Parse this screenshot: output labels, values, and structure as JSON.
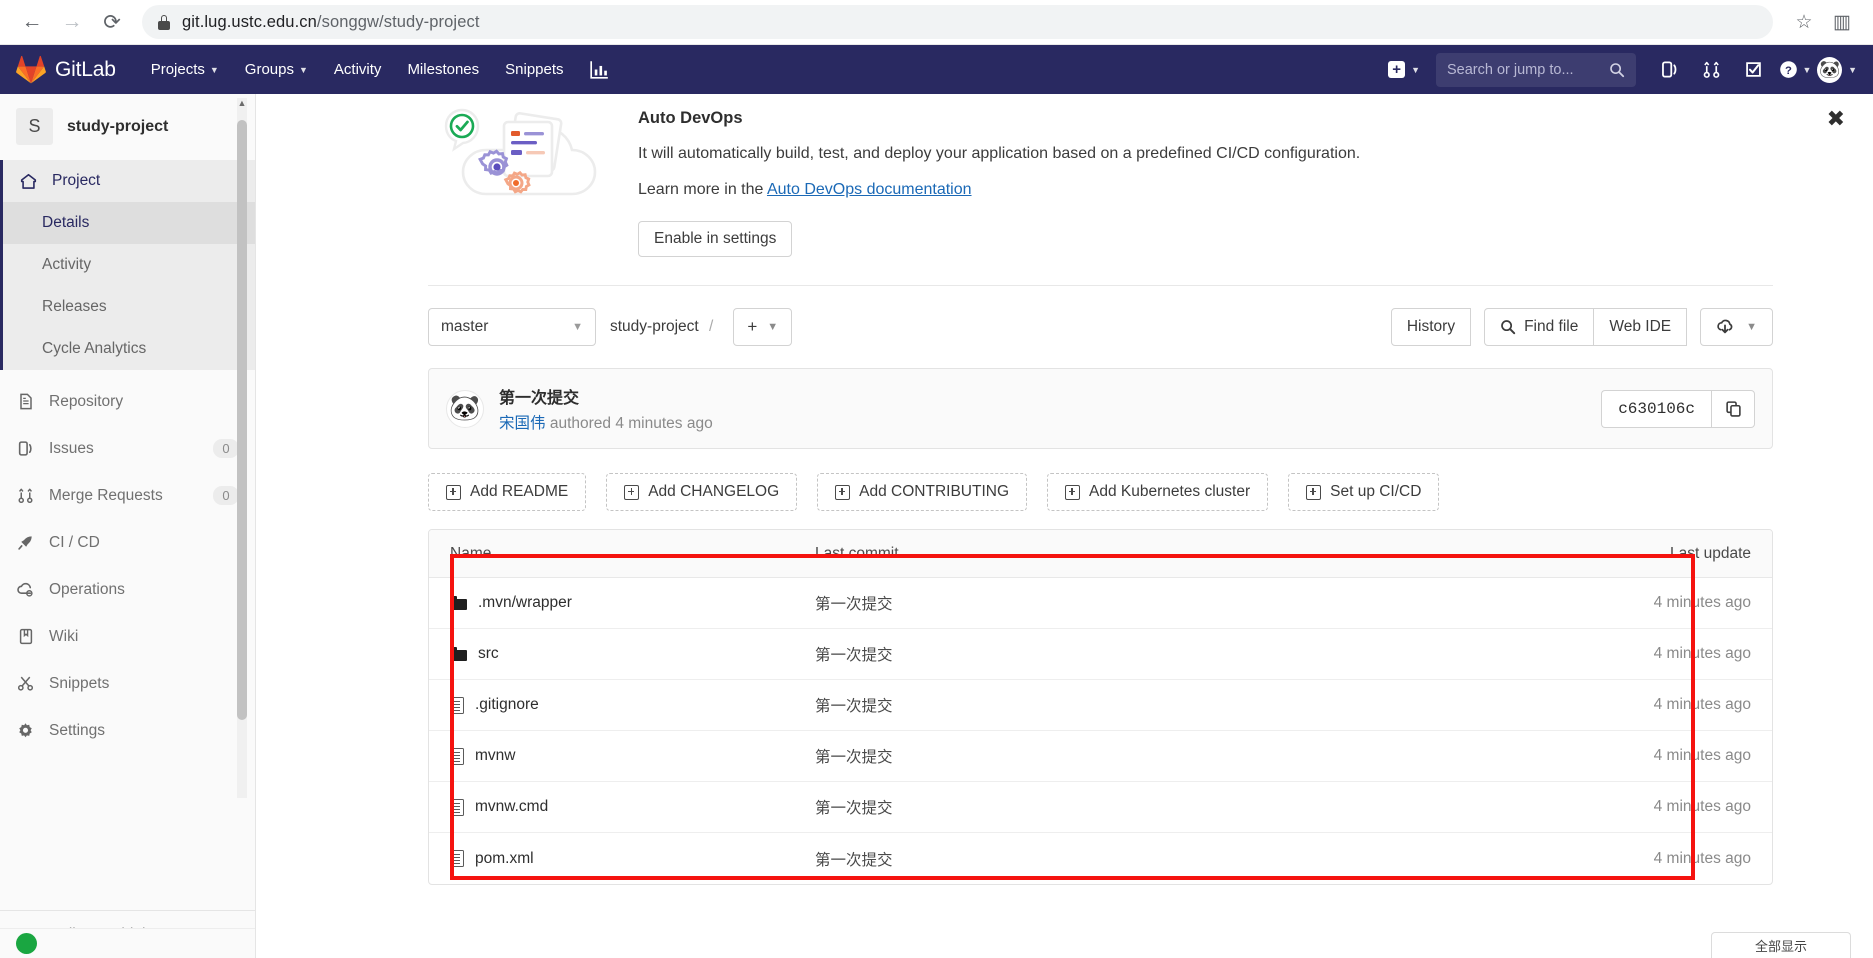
{
  "browser": {
    "back_icon": "←",
    "forward_icon": "→",
    "reload_icon": "⟳",
    "lock_icon": "lock-icon",
    "url_host": "git.lug.ustc.edu.cn",
    "url_path": "/songgw/study-project",
    "star_icon": "☆",
    "extensions_icon": "▥"
  },
  "navbar": {
    "brand": "GitLab",
    "links": [
      {
        "label": "Projects",
        "has_caret": true
      },
      {
        "label": "Groups",
        "has_caret": true
      },
      {
        "label": "Activity",
        "has_caret": false
      },
      {
        "label": "Milestones",
        "has_caret": false
      },
      {
        "label": "Snippets",
        "has_caret": false
      }
    ],
    "chart_icon": "chart-icon",
    "plus_icon": "+",
    "search_placeholder": "Search or jump to...",
    "search_icon": "search-icon",
    "icons": [
      "issues-icon",
      "merge-requests-icon",
      "todos-icon",
      "help-icon"
    ],
    "avatar_icon": "🐼",
    "caret": "⌄"
  },
  "sidebar": {
    "project_initial": "S",
    "project_name": "study-project",
    "group_label": "Project",
    "group_icon": "home-icon",
    "sub_items": [
      {
        "label": "Details",
        "active": true
      },
      {
        "label": "Activity",
        "active": false
      },
      {
        "label": "Releases",
        "active": false
      },
      {
        "label": "Cycle Analytics",
        "active": false
      }
    ],
    "items": [
      {
        "label": "Repository",
        "icon": "repository-icon",
        "badge": ""
      },
      {
        "label": "Issues",
        "icon": "issues-icon",
        "badge": "0"
      },
      {
        "label": "Merge Requests",
        "icon": "merge-requests-icon",
        "badge": "0"
      },
      {
        "label": "CI / CD",
        "icon": "rocket-icon",
        "badge": ""
      },
      {
        "label": "Operations",
        "icon": "operations-icon",
        "badge": ""
      },
      {
        "label": "Wiki",
        "icon": "wiki-icon",
        "badge": ""
      },
      {
        "label": "Snippets",
        "icon": "snippets-icon",
        "badge": ""
      },
      {
        "label": "Settings",
        "icon": "gear-icon",
        "badge": ""
      }
    ],
    "collapse_label": "Collapse sidebar",
    "collapse_icon": "«"
  },
  "devops_banner": {
    "title": "Auto DevOps",
    "description": "It will automatically build, test, and deploy your application based on a predefined CI/CD configuration.",
    "learn_prefix": "Learn more in the ",
    "learn_link": "Auto DevOps documentation",
    "enable_button": "Enable in settings",
    "close_icon": "✖"
  },
  "repo_toolbar": {
    "branch": "master",
    "breadcrumb_project": "study-project",
    "breadcrumb_sep": "/",
    "plus_label": "+",
    "history_label": "History",
    "find_file_label": "Find file",
    "find_file_icon": "search-icon",
    "web_ide_label": "Web IDE",
    "download_icon": "download-icon",
    "caret": "⌄"
  },
  "commit": {
    "avatar_icon": "🐼",
    "title": "第一次提交",
    "author": "宋国伟",
    "meta_suffix": " authored 4 minutes ago",
    "sha": "c630106c",
    "copy_icon": "copy-icon"
  },
  "quick_actions": [
    {
      "label": "Add README",
      "icon": "plus-square-icon"
    },
    {
      "label": "Add CHANGELOG",
      "icon": "plus-square-icon"
    },
    {
      "label": "Add CONTRIBUTING",
      "icon": "plus-square-icon"
    },
    {
      "label": "Add Kubernetes cluster",
      "icon": "plus-square-icon"
    },
    {
      "label": "Set up CI/CD",
      "icon": "plus-square-icon"
    }
  ],
  "file_table": {
    "columns": {
      "name": "Name",
      "last_commit": "Last commit",
      "last_update": "Last update"
    },
    "rows": [
      {
        "name": ".mvn/wrapper",
        "type": "folder",
        "last_commit": "第一次提交",
        "last_update": "4 minutes ago"
      },
      {
        "name": "src",
        "type": "folder",
        "last_commit": "第一次提交",
        "last_update": "4 minutes ago"
      },
      {
        "name": ".gitignore",
        "type": "file",
        "last_commit": "第一次提交",
        "last_update": "4 minutes ago"
      },
      {
        "name": "mvnw",
        "type": "file",
        "last_commit": "第一次提交",
        "last_update": "4 minutes ago"
      },
      {
        "name": "mvnw.cmd",
        "type": "file",
        "last_commit": "第一次提交",
        "last_update": "4 minutes ago"
      },
      {
        "name": "pom.xml",
        "type": "file",
        "last_commit": "第一次提交",
        "last_update": "4 minutes ago"
      }
    ]
  },
  "corner_badge": {
    "label": "全部显示"
  },
  "colors": {
    "navbar": "#292961",
    "link": "#1b69b6",
    "annotation": "#f5130f",
    "gitlab_orange": "#e24329"
  }
}
